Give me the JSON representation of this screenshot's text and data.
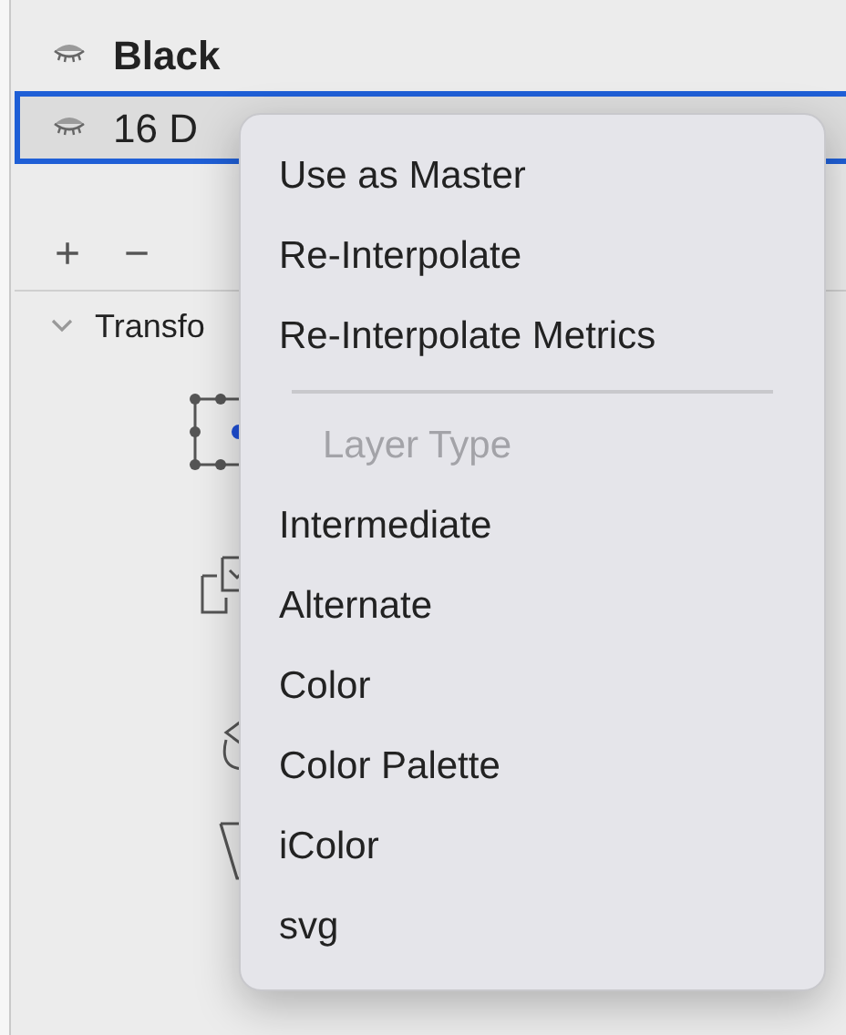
{
  "layers": [
    {
      "name": "Black",
      "bold": true,
      "selected": false
    },
    {
      "name": "16 D",
      "bold": false,
      "selected": true
    }
  ],
  "toolbar": {
    "add": "+",
    "remove": "−"
  },
  "section": {
    "title": "Transfo",
    "expanded": true
  },
  "context_menu": [
    {
      "kind": "item",
      "label": "Use as Master"
    },
    {
      "kind": "item",
      "label": "Re-Interpolate"
    },
    {
      "kind": "item",
      "label": "Re-Interpolate Metrics"
    },
    {
      "kind": "separator"
    },
    {
      "kind": "header",
      "label": "Layer Type"
    },
    {
      "kind": "item",
      "label": "Intermediate"
    },
    {
      "kind": "item",
      "label": "Alternate"
    },
    {
      "kind": "item",
      "label": "Color"
    },
    {
      "kind": "item",
      "label": "Color Palette"
    },
    {
      "kind": "item",
      "label": "iColor"
    },
    {
      "kind": "item",
      "label": "svg"
    }
  ]
}
